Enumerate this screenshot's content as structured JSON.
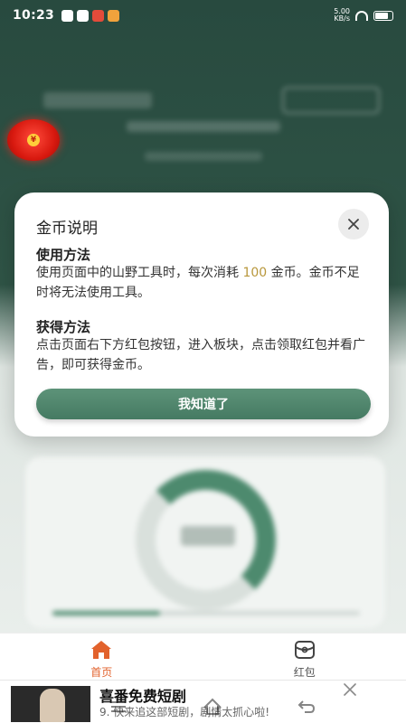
{
  "status_bar": {
    "time": "10:23",
    "net_speed": "5.00",
    "net_unit": "KB/s"
  },
  "modal": {
    "title": "金币说明",
    "usage_heading": "使用方法",
    "usage_text_before": "使用页面中的山野工具时，每次消耗 ",
    "usage_highlight": "100",
    "usage_text_after": " 金币。金币不足时将无法使用工具。",
    "earn_heading": "获得方法",
    "earn_text": "点击页面右下方红包按钮，进入板块，点击领取红包并看广告，即可获得金币。",
    "confirm_label": "我知道了"
  },
  "bottom_nav": {
    "items": [
      {
        "label": "首页",
        "icon": "home-icon",
        "active": true
      },
      {
        "label": "红包",
        "icon": "red-packet-icon",
        "active": false
      }
    ],
    "active_color": "#e2622c"
  },
  "ad": {
    "title": "喜番免费短剧",
    "subtitle": "9. 快来追这部短剧，剧情太抓心啦!"
  },
  "colors": {
    "accent_green": "#4d8a6e",
    "highlight_gold": "#b8973b"
  }
}
